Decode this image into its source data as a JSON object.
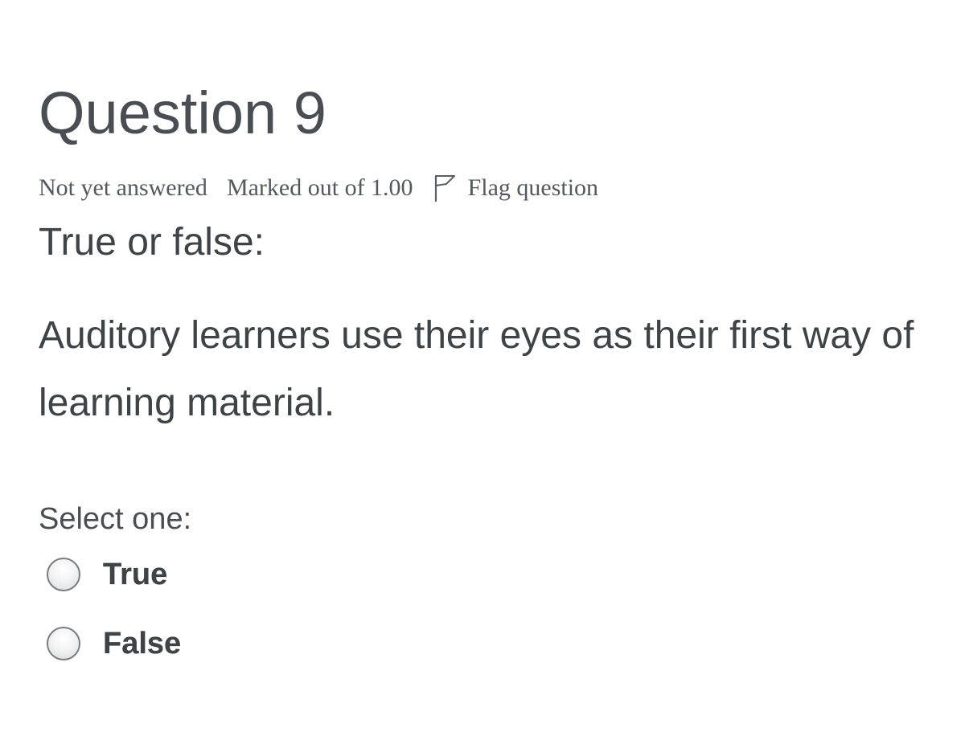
{
  "question": {
    "title": "Question 9",
    "info": {
      "state": "Not yet answered",
      "grade": "Marked out of 1.00",
      "flag_label": "Flag question",
      "flag_icon": "flag-icon"
    },
    "prompt": "True or false:",
    "text": "Auditory learners use their eyes as their first way of learning material.",
    "select_label": "Select one:",
    "options": [
      {
        "label": "True",
        "selected": false
      },
      {
        "label": "False",
        "selected": false
      }
    ]
  },
  "colors": {
    "text": "#4a4e52",
    "radio_border": "#7a7d80",
    "background": "#ffffff"
  }
}
